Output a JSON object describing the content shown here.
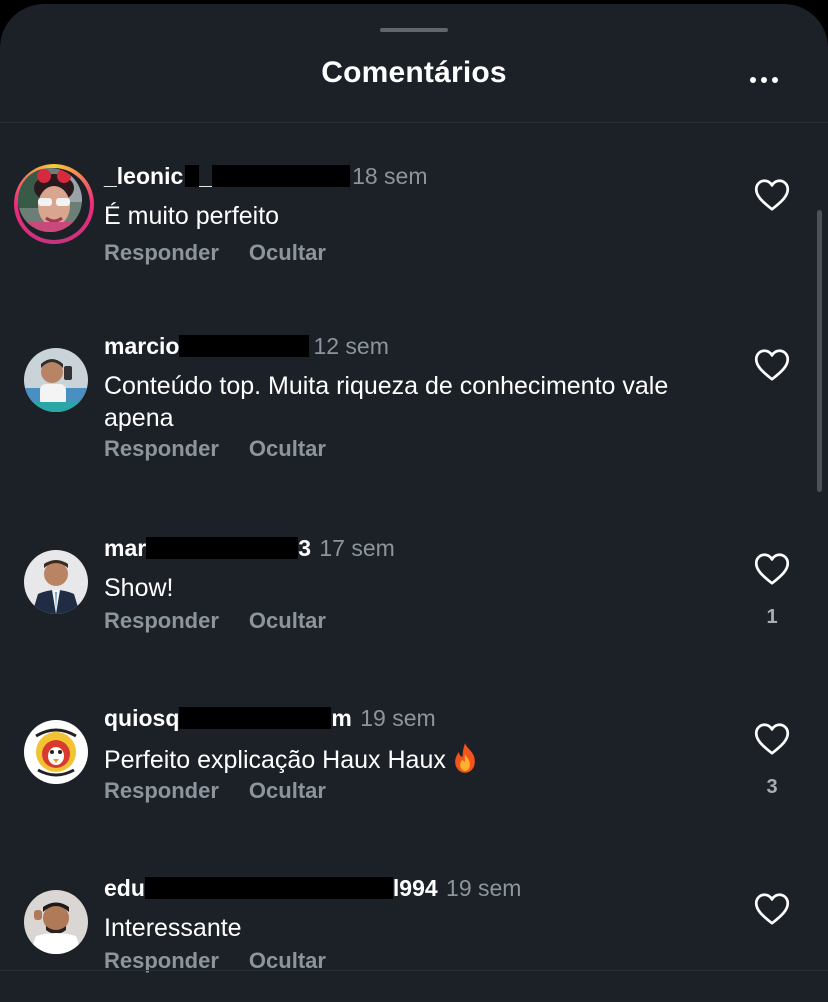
{
  "header": {
    "title": "Comentários",
    "more_icon": "more-horizontal-icon"
  },
  "actions": {
    "reply_label": "Responder",
    "hide_label": "Ocultar"
  },
  "colors": {
    "background": "#1b2127",
    "secondary_text": "#8d959c",
    "story_ring": "#ee2a7b"
  },
  "comments": [
    {
      "user_visible_prefix": "_leonic",
      "user_visible_mid": "_",
      "user_visible_suffix": "",
      "time": "18 sem",
      "text": "É muito perfeito",
      "likes": "",
      "has_story": true
    },
    {
      "user_visible_prefix": "marcio",
      "user_visible_mid": "",
      "user_visible_suffix": "",
      "time": "12 sem",
      "text": "Conteúdo top. Muita riqueza de conhecimento vale apena",
      "likes": "",
      "has_story": false
    },
    {
      "user_visible_prefix": "mar",
      "user_visible_mid": "",
      "user_visible_suffix": "3",
      "time": "17 sem",
      "text": "Show!",
      "likes": "1",
      "has_story": false
    },
    {
      "user_visible_prefix": "quiosq",
      "user_visible_mid": "",
      "user_visible_suffix": "m",
      "time": "19 sem",
      "text": "Perfeito explicação Haux Haux",
      "emoji": "fire-emoji",
      "likes": "3",
      "has_story": false
    },
    {
      "user_visible_prefix": "edu",
      "user_visible_mid": "",
      "user_visible_suffix": "l994",
      "time": "19 sem",
      "text": "Interessante",
      "likes": "",
      "has_story": false
    }
  ]
}
